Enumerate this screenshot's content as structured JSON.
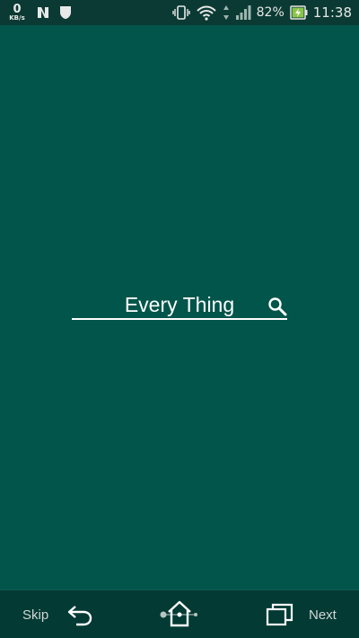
{
  "status_bar": {
    "data_rate_value": "0",
    "data_rate_unit": "KB/s",
    "battery_percent": "82%",
    "time": "11:38"
  },
  "search": {
    "text": "Every Thing",
    "icon": "search-icon"
  },
  "nav": {
    "skip_label": "Skip",
    "next_label": "Next"
  },
  "colors": {
    "background": "#02554a",
    "status_bar": "#0a3a33",
    "nav_bar": "#033a33",
    "battery_accent": "#8bc34a"
  }
}
